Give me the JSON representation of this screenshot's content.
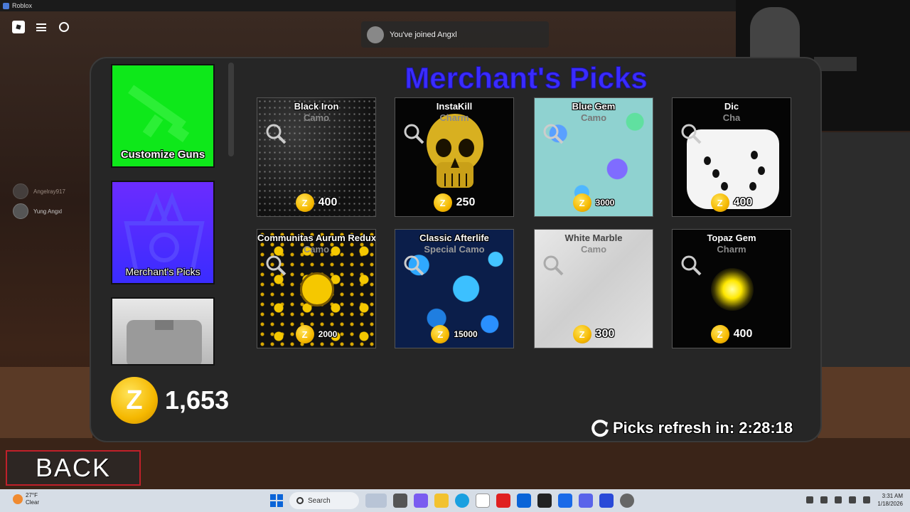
{
  "window": {
    "title": "Roblox"
  },
  "toast": {
    "text": "You've joined Angxl"
  },
  "players": [
    {
      "name": "Angelray917"
    },
    {
      "name": "Yung Angxl"
    }
  ],
  "nav": {
    "customize_guns": "Customize Guns",
    "merchants_picks": "Merchant's Picks"
  },
  "heading": "Merchant's Picks",
  "items": [
    {
      "name": "Black Iron",
      "type": "Camo",
      "price": "400"
    },
    {
      "name": "InstaKill",
      "type": "Charm",
      "price": "250"
    },
    {
      "name": "Blue Gem",
      "type": "Camo",
      "price": "3000"
    },
    {
      "name": "Dic",
      "type": "Cha",
      "price": "400"
    },
    {
      "name": "Communitas Aurum Redux",
      "type": "Camo",
      "price": "2000"
    },
    {
      "name": "Classic Afterlife",
      "type": "Special Camo",
      "price": "15000"
    },
    {
      "name": "White Marble",
      "type": "Camo",
      "price": "300"
    },
    {
      "name": "Topaz Gem",
      "type": "Charm",
      "price": "400"
    }
  ],
  "coin_symbol": "Z",
  "balance": "1,653",
  "refresh": {
    "label": "Picks refresh in: 2:28:18"
  },
  "back_label": "BACK",
  "taskbar": {
    "weather_temp": "27°F",
    "weather_desc": "Clear",
    "search_label": "Search",
    "time": "3:31 AM",
    "date": "1/18/2026"
  },
  "colors": {
    "accent_purple": "#3a2cff",
    "customize_green": "#0ee81a",
    "coin_gold": "#f5b800",
    "back_border": "#c0202a"
  }
}
